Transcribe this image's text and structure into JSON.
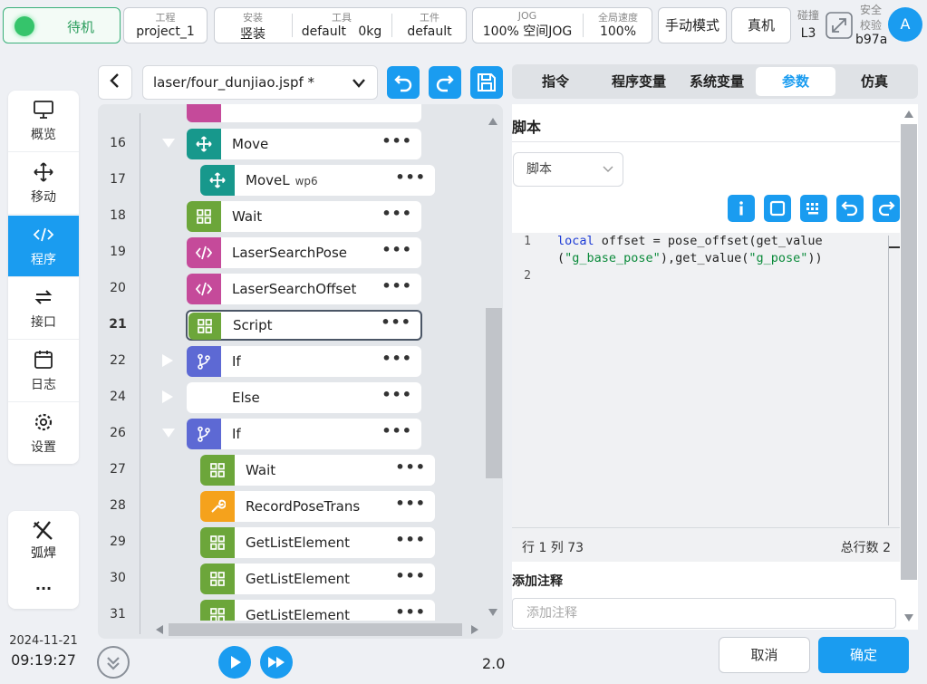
{
  "status": {
    "label": "待机",
    "color": "#35c46b"
  },
  "topbar": {
    "project": {
      "k": "工程",
      "v": "project_1"
    },
    "install": {
      "k": "安装",
      "v": "竖装"
    },
    "tool": {
      "k": "工具",
      "v": "default",
      "weight": "0kg"
    },
    "workpiece": {
      "k": "工件",
      "v": "default"
    },
    "jog": {
      "k": "JOG",
      "v": "100%  空间JOG"
    },
    "global_speed": {
      "k": "全局速度",
      "v": "100%"
    },
    "manual_mode": "手动模式",
    "real_machine": "真机",
    "collision": {
      "k": "碰撞",
      "v": "L3"
    },
    "safety": {
      "k1": "安全",
      "k2": "校验",
      "v": "b97a"
    },
    "avatar": "A"
  },
  "nav": {
    "items": [
      {
        "label": "概览",
        "icon": "monitor-icon"
      },
      {
        "label": "移动",
        "icon": "move-icon"
      },
      {
        "label": "程序",
        "icon": "code-icon"
      },
      {
        "label": "接口",
        "icon": "swap-icon"
      },
      {
        "label": "日志",
        "icon": "calendar-icon"
      },
      {
        "label": "设置",
        "icon": "gear-icon"
      }
    ],
    "weld": "弧焊",
    "more": "···"
  },
  "clock": {
    "date": "2024-11-21",
    "time": "09:19:27"
  },
  "program": {
    "file": "laser/four_dunjiao.jspf *",
    "speed": "2.0",
    "rows": [
      {
        "num": "16",
        "label": "Move",
        "sub": "",
        "color": "teal"
      },
      {
        "num": "17",
        "label": "MoveL",
        "sub": "wp6",
        "color": "teal"
      },
      {
        "num": "18",
        "label": "Wait",
        "sub": "",
        "color": "green"
      },
      {
        "num": "19",
        "label": "LaserSearchPose",
        "sub": "",
        "color": "pink"
      },
      {
        "num": "20",
        "label": "LaserSearchOffset",
        "sub": "",
        "color": "pink"
      },
      {
        "num": "21",
        "label": "Script",
        "sub": "",
        "color": "green"
      },
      {
        "num": "22",
        "label": "If",
        "sub": "",
        "color": "purple"
      },
      {
        "num": "24",
        "label": "Else",
        "sub": "",
        "color": "none"
      },
      {
        "num": "26",
        "label": "If",
        "sub": "",
        "color": "purple"
      },
      {
        "num": "27",
        "label": "Wait",
        "sub": "",
        "color": "green"
      },
      {
        "num": "28",
        "label": "RecordPoseTrans",
        "sub": "",
        "color": "orange"
      },
      {
        "num": "29",
        "label": "GetListElement",
        "sub": "",
        "color": "green"
      },
      {
        "num": "30",
        "label": "GetListElement",
        "sub": "",
        "color": "green"
      },
      {
        "num": "31",
        "label": "GetListElement",
        "sub": "",
        "color": "green"
      }
    ]
  },
  "right": {
    "tabs": [
      "指令",
      "程序变量",
      "系统变量",
      "参数",
      "仿真"
    ],
    "active_tab": "参数",
    "section_title": "脚本",
    "dropdown": "脚本",
    "code": {
      "line1_a": "local",
      "line1_b": " offset = pose_offset(get_value",
      "line1c_a": "(",
      "line1c_s1": "\"g_base_pose\"",
      "line1c_b": "),get_value(",
      "line1c_s2": "\"g_pose\"",
      "line1c_c": "))",
      "ln1": "1",
      "ln2": "2"
    },
    "status_left": "行 1 列 73",
    "status_right": "总行数 2",
    "note_title": "添加注释",
    "note_placeholder": "添加注释",
    "cancel": "取消",
    "confirm": "确定"
  }
}
